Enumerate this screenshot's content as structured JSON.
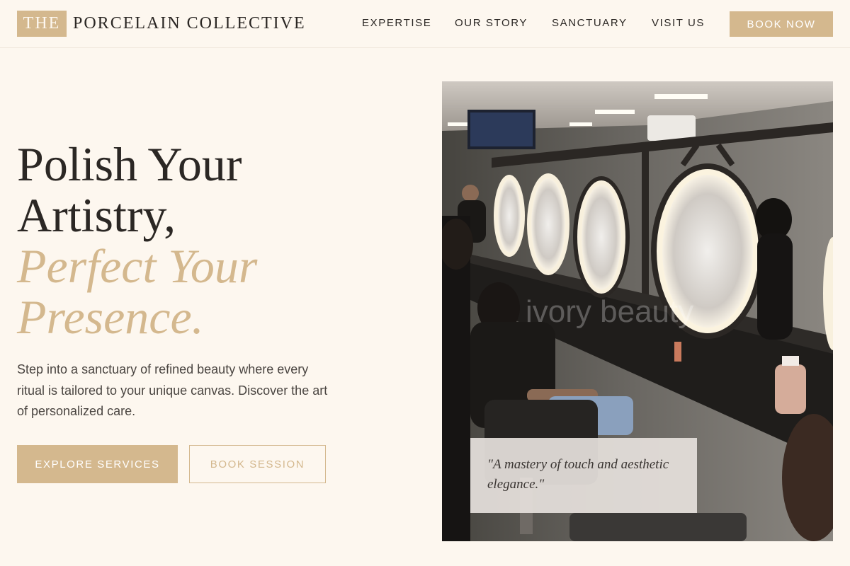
{
  "header": {
    "logo_mark": "THE",
    "logo_text": "PORCELAIN COLLECTIVE",
    "nav": [
      {
        "label": "EXPERTISE"
      },
      {
        "label": "OUR STORY"
      },
      {
        "label": "SANCTUARY"
      },
      {
        "label": "VISIT US"
      }
    ],
    "book_now": "BOOK NOW"
  },
  "hero": {
    "headline_line1": "Polish Your",
    "headline_line2": "Artistry,",
    "headline_line3": "Perfect Your",
    "headline_line4": "Presence.",
    "subtext": "Step into a sanctuary of refined beauty where every ritual is tailored to your unique canvas. Discover the art of personalized care.",
    "primary_button": "EXPLORE SERVICES",
    "secondary_button": "BOOK SESSION"
  },
  "photo": {
    "watermark": "ivory beauty",
    "quote": "\"A mastery of touch and aesthetic elegance.\""
  },
  "colors": {
    "background": "#fdf7ef",
    "accent": "#d4b88e",
    "text": "#2b2724"
  }
}
